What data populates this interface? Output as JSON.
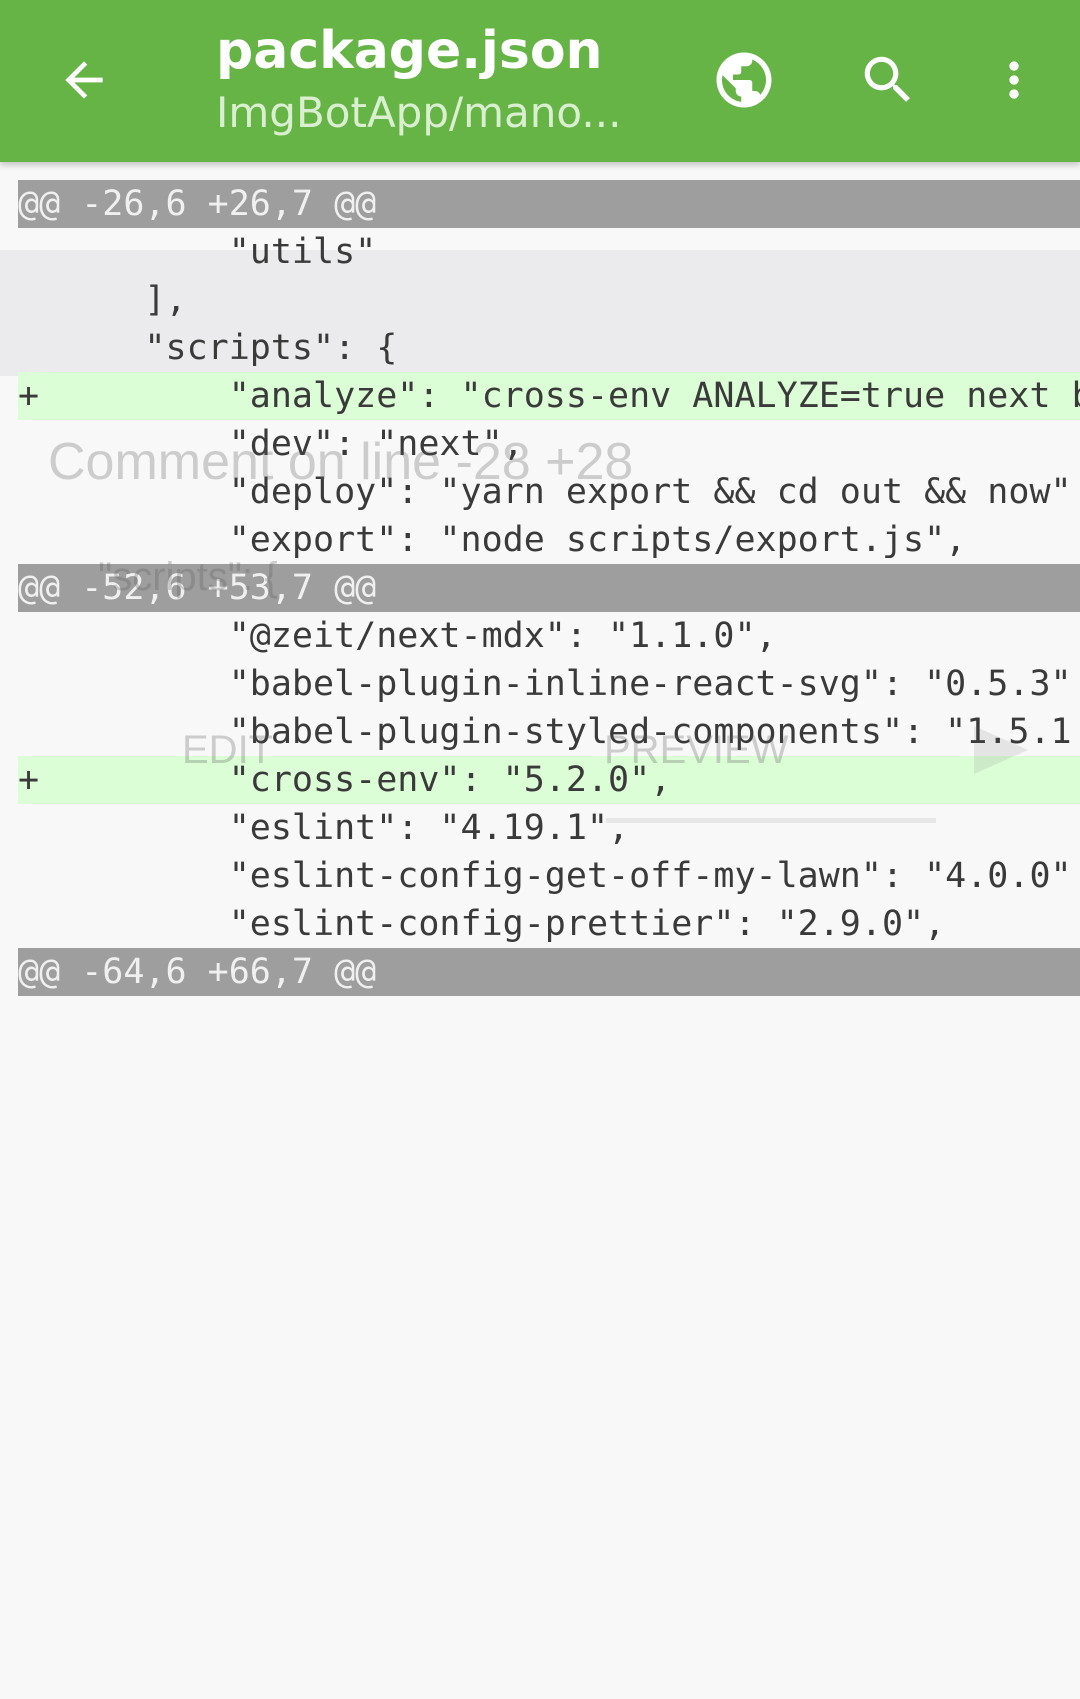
{
  "appbar": {
    "title": "package.json",
    "subtitle": "ImgBotApp/mano...",
    "icons": {
      "back": "arrow-left-icon",
      "open_in_browser": "globe-icon",
      "search": "search-icon",
      "more": "more-vert-icon"
    }
  },
  "colors": {
    "appbar": "#66b446",
    "hunk_header": "#9e9e9e",
    "added_line": "#dcfed6",
    "selection": "#ebebed",
    "background": "#f8f8f8"
  },
  "diff": {
    "lines": [
      {
        "type": "hunk",
        "text": "@@ -26,6 +26,7 @@"
      },
      {
        "type": "context",
        "text": "          \"utils\""
      },
      {
        "type": "context",
        "text": "      ],"
      },
      {
        "type": "context",
        "text": "      \"scripts\": {"
      },
      {
        "type": "added",
        "text": "+         \"analyze\": \"cross-env ANALYZE=true next b"
      },
      {
        "type": "context",
        "text": "          \"dev\": \"next\","
      },
      {
        "type": "context",
        "text": "          \"deploy\": \"yarn export && cd out && now\""
      },
      {
        "type": "context",
        "text": "          \"export\": \"node scripts/export.js\","
      },
      {
        "type": "hunk",
        "text": "@@ -52,6 +53,7 @@"
      },
      {
        "type": "context",
        "text": "          \"@zeit/next-mdx\": \"1.1.0\","
      },
      {
        "type": "context",
        "text": "          \"babel-plugin-inline-react-svg\": \"0.5.3\""
      },
      {
        "type": "context",
        "text": "          \"babel-plugin-styled-components\": \"1.5.1"
      },
      {
        "type": "added",
        "text": "+         \"cross-env\": \"5.2.0\","
      },
      {
        "type": "context",
        "text": "          \"eslint\": \"4.19.1\","
      },
      {
        "type": "context",
        "text": "          \"eslint-config-get-off-my-lawn\": \"4.0.0\""
      },
      {
        "type": "context",
        "text": "          \"eslint-config-prettier\": \"2.9.0\","
      },
      {
        "type": "hunk",
        "text": "@@ -64,6 +66,7 @@"
      }
    ]
  },
  "comment_dialog": {
    "title": "Comment on line -28 +28",
    "input_text": "\"scripts\": {",
    "tabs": [
      "EDIT",
      "PREVIEW"
    ],
    "send_icon": "send-icon"
  }
}
